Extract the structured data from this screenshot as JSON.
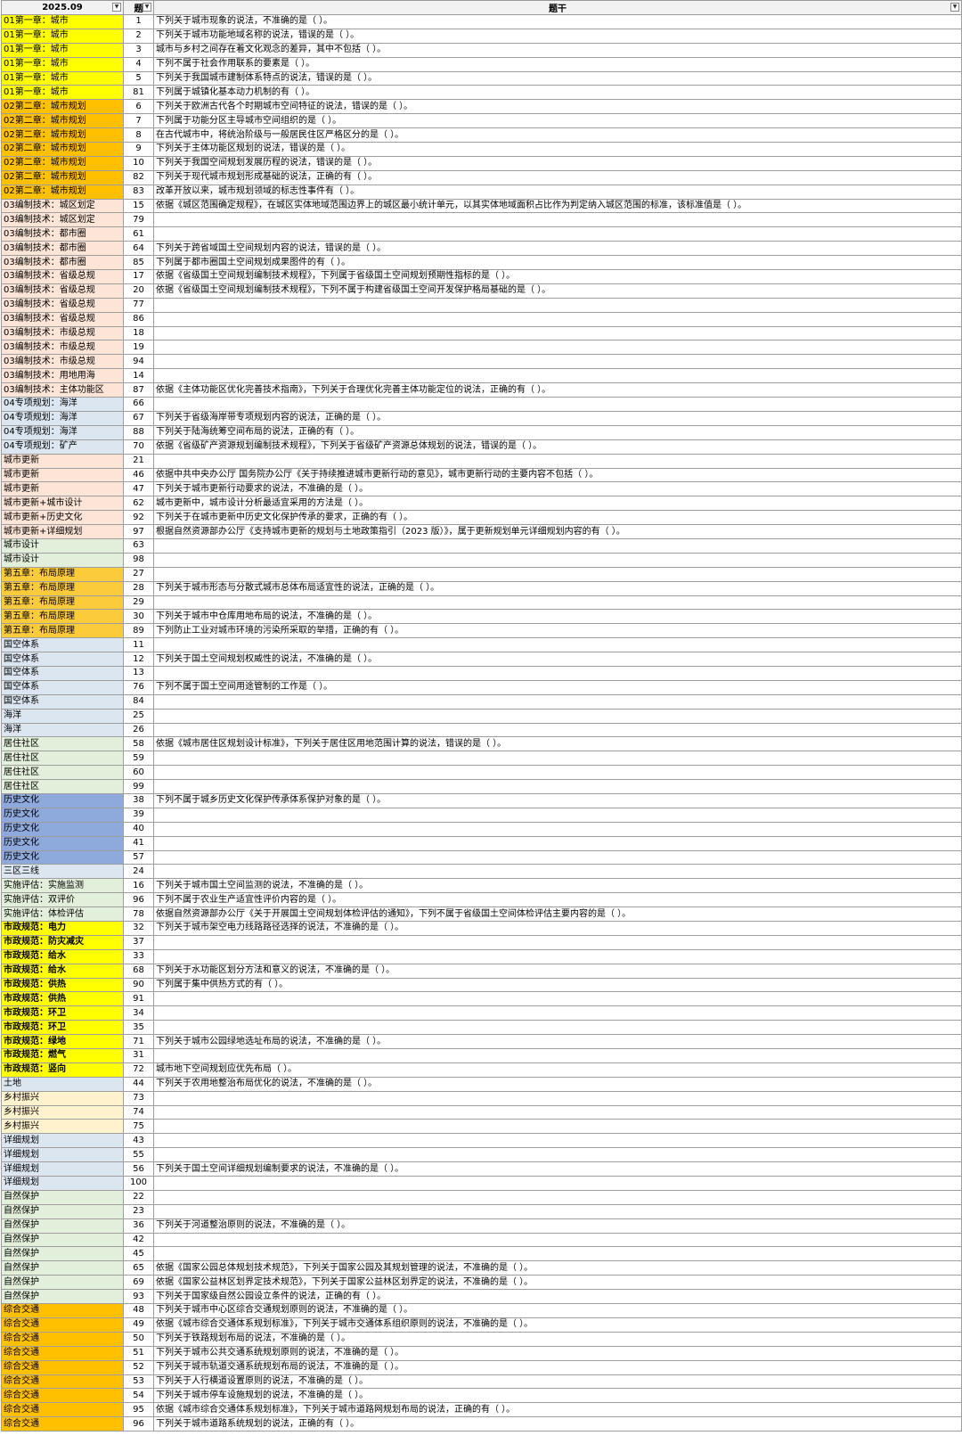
{
  "header": {
    "col1": "2025.09",
    "col2": "题",
    "col3": "题干"
  },
  "colors": {
    "yellow": "#ffff00",
    "orange": "#ffc000",
    "peach": "#fce4d6",
    "gold": "#fbcb3b",
    "light_blue": "#dce6f1",
    "blue": "#8ea9db",
    "light_green": "#e2efda",
    "sand": "#fff2cc",
    "white": "#ffffff"
  },
  "rows": [
    {
      "cat": "01第一章：城市",
      "n": "1",
      "text": "下列关于城市现象的说法，不准确的是（ ）。",
      "color": "yellow"
    },
    {
      "cat": "01第一章：城市",
      "n": "2",
      "text": "下列关于城市功能地域名称的说法，错误的是（ ）。",
      "color": "yellow"
    },
    {
      "cat": "01第一章：城市",
      "n": "3",
      "text": "城市与乡村之间存在着文化观念的差异，其中不包括（ ）。",
      "color": "yellow"
    },
    {
      "cat": "01第一章：城市",
      "n": "4",
      "text": "下列不属于社会作用联系的要素是（ ）。",
      "color": "yellow"
    },
    {
      "cat": "01第一章：城市",
      "n": "5",
      "text": "下列关于我国城市建制体系特点的说法，错误的是（ ）。",
      "color": "yellow"
    },
    {
      "cat": "01第一章：城市",
      "n": "81",
      "text": "下列属于城镇化基本动力机制的有（ ）。",
      "color": "yellow"
    },
    {
      "cat": "02第二章：城市规划",
      "n": "6",
      "text": "下列关于欧洲古代各个时期城市空间特征的说法，错误的是（ ）。",
      "color": "orange"
    },
    {
      "cat": "02第二章：城市规划",
      "n": "7",
      "text": "下列属于功能分区主导城市空间组织的是（ ）。",
      "color": "orange"
    },
    {
      "cat": "02第二章：城市规划",
      "n": "8",
      "text": "在古代城市中，将统治阶级与一般居民住区严格区分的是（ ）。",
      "color": "orange"
    },
    {
      "cat": "02第二章：城市规划",
      "n": "9",
      "text": "下列关于主体功能区规划的说法，错误的是（ ）。",
      "color": "orange"
    },
    {
      "cat": "02第二章：城市规划",
      "n": "10",
      "text": "下列关于我国空间规划发展历程的说法，错误的是（ ）。",
      "color": "orange"
    },
    {
      "cat": "02第二章：城市规划",
      "n": "82",
      "text": "下列关于现代城市规划形成基础的说法，正确的有（ ）。",
      "color": "orange"
    },
    {
      "cat": "02第二章：城市规划",
      "n": "83",
      "text": "改革开放以来，城市规划领域的标志性事件有（ ）。",
      "color": "orange"
    },
    {
      "cat": "03编制技术：城区划定",
      "n": "15",
      "text": "依据《城区范围确定规程》，在城区实体地域范围边界上的城区最小统计单元，以其实体地域面积占比作为判定纳入城区范围的标准，该标准值是（ ）。",
      "color": "peach"
    },
    {
      "cat": "03编制技术：城区划定",
      "n": "79",
      "text": "",
      "color": "peach"
    },
    {
      "cat": "03编制技术：都市圈",
      "n": "61",
      "text": "",
      "color": "peach"
    },
    {
      "cat": "03编制技术：都市圈",
      "n": "64",
      "text": "下列关于跨省域国土空间规划内容的说法，错误的是（ ）。",
      "color": "peach"
    },
    {
      "cat": "03编制技术：都市圈",
      "n": "85",
      "text": "下列属于都市圈国土空间规划成果图件的有（ ）。",
      "color": "peach"
    },
    {
      "cat": "03编制技术：省级总规",
      "n": "17",
      "text": "依据《省级国土空间规划编制技术规程》，下列属于省级国土空间规划预期性指标的是（ ）。",
      "color": "peach"
    },
    {
      "cat": "03编制技术：省级总规",
      "n": "20",
      "text": "依据《省级国土空间规划编制技术规程》，下列不属于构建省级国土空间开发保护格局基础的是（ ）。",
      "color": "peach"
    },
    {
      "cat": "03编制技术：省级总规",
      "n": "77",
      "text": "",
      "color": "peach"
    },
    {
      "cat": "03编制技术：省级总规",
      "n": "86",
      "text": "",
      "color": "peach"
    },
    {
      "cat": "03编制技术：市级总规",
      "n": "18",
      "text": "",
      "color": "peach"
    },
    {
      "cat": "03编制技术：市级总规",
      "n": "19",
      "text": "",
      "color": "peach"
    },
    {
      "cat": "03编制技术：市级总规",
      "n": "94",
      "text": "",
      "color": "peach"
    },
    {
      "cat": "03编制技术：用地用海",
      "n": "14",
      "text": "",
      "color": "peach"
    },
    {
      "cat": "03编制技术：主体功能区",
      "n": "87",
      "text": "依据《主体功能区优化完善技术指南》，下列关于合理优化完善主体功能定位的说法，正确的有（ ）。",
      "color": "peach"
    },
    {
      "cat": "04专项规划：海洋",
      "n": "66",
      "text": "",
      "color": "light_blue"
    },
    {
      "cat": "04专项规划：海洋",
      "n": "67",
      "text": "下列关于省级海岸带专项规划内容的说法，正确的是（ ）。",
      "color": "light_blue"
    },
    {
      "cat": "04专项规划：海洋",
      "n": "88",
      "text": "下列关于陆海统筹空间布局的说法，正确的有（ ）。",
      "color": "light_blue"
    },
    {
      "cat": "04专项规划：矿产",
      "n": "70",
      "text": "依据《省级矿产资源规划编制技术规程》，下列关于省级矿产资源总体规划的说法，错误的是（ ）。",
      "color": "light_blue"
    },
    {
      "cat": "城市更新",
      "n": "21",
      "text": "",
      "color": "peach"
    },
    {
      "cat": "城市更新",
      "n": "46",
      "text": "依据中共中央办公厅 国务院办公厅《关于持续推进城市更新行动的意见》，城市更新行动的主要内容不包括（ ）。",
      "color": "peach"
    },
    {
      "cat": "城市更新",
      "n": "47",
      "text": "下列关于城市更新行动要求的说法，不准确的是（ ）。",
      "color": "peach"
    },
    {
      "cat": "城市更新+城市设计",
      "n": "62",
      "text": "城市更新中，城市设计分析最适宜采用的方法是（ ）。",
      "color": "peach"
    },
    {
      "cat": "城市更新+历史文化",
      "n": "92",
      "text": "下列关于在城市更新中历史文化保护传承的要求，正确的有（ ）。",
      "color": "peach"
    },
    {
      "cat": "城市更新+详细规划",
      "n": "97",
      "text": "根据自然资源部办公厅《支持城市更新的规划与土地政策指引（2023 版）》，属于更新规划单元详细规划内容的有（ ）。",
      "color": "peach"
    },
    {
      "cat": "城市设计",
      "n": "63",
      "text": "",
      "color": "light_green"
    },
    {
      "cat": "城市设计",
      "n": "98",
      "text": "",
      "color": "light_green"
    },
    {
      "cat": "第五章：布局原理",
      "n": "27",
      "text": "",
      "color": "gold"
    },
    {
      "cat": "第五章：布局原理",
      "n": "28",
      "text": "下列关于城市形态与分散式城市总体布局适宜性的说法，正确的是（ ）。",
      "color": "gold"
    },
    {
      "cat": "第五章：布局原理",
      "n": "29",
      "text": "",
      "color": "gold"
    },
    {
      "cat": "第五章：布局原理",
      "n": "30",
      "text": "下列关于城市中仓库用地布局的说法，不准确的是（ ）。",
      "color": "gold"
    },
    {
      "cat": "第五章：布局原理",
      "n": "89",
      "text": "下列防止工业对城市环境的污染所采取的举措，正确的有（ ）。",
      "color": "gold"
    },
    {
      "cat": "国空体系",
      "n": "11",
      "text": "",
      "color": "light_blue"
    },
    {
      "cat": "国空体系",
      "n": "12",
      "text": "下列关于国土空间规划权威性的说法，不准确的是（ ）。",
      "color": "light_blue"
    },
    {
      "cat": "国空体系",
      "n": "13",
      "text": "",
      "color": "light_blue"
    },
    {
      "cat": "国空体系",
      "n": "76",
      "text": "下列不属于国土空间用途管制的工作是（ ）。",
      "color": "light_blue"
    },
    {
      "cat": "国空体系",
      "n": "84",
      "text": "",
      "color": "light_blue"
    },
    {
      "cat": "海洋",
      "n": "25",
      "text": "",
      "color": "light_blue"
    },
    {
      "cat": "海洋",
      "n": "26",
      "text": "",
      "color": "light_blue"
    },
    {
      "cat": "居住社区",
      "n": "58",
      "text": "依据《城市居住区规划设计标准》，下列关于居住区用地范围计算的说法，错误的是（ ）。",
      "color": "light_green"
    },
    {
      "cat": "居住社区",
      "n": "59",
      "text": "",
      "color": "light_green"
    },
    {
      "cat": "居住社区",
      "n": "60",
      "text": "",
      "color": "light_green"
    },
    {
      "cat": "居住社区",
      "n": "99",
      "text": "",
      "color": "light_green"
    },
    {
      "cat": "历史文化",
      "n": "38",
      "text": "下列不属于城乡历史文化保护传承体系保护对象的是（ ）。",
      "color": "blue"
    },
    {
      "cat": "历史文化",
      "n": "39",
      "text": "",
      "color": "blue"
    },
    {
      "cat": "历史文化",
      "n": "40",
      "text": "",
      "color": "blue"
    },
    {
      "cat": "历史文化",
      "n": "41",
      "text": "",
      "color": "blue"
    },
    {
      "cat": "历史文化",
      "n": "57",
      "text": "",
      "color": "blue"
    },
    {
      "cat": "三区三线",
      "n": "24",
      "text": "",
      "color": "light_blue"
    },
    {
      "cat": "实施评估：实施监测",
      "n": "16",
      "text": "下列关于城市国土空间监测的说法，不准确的是（ ）。",
      "color": "light_green"
    },
    {
      "cat": "实施评估：双评价",
      "n": "96",
      "text": "下列不属于农业生产适宜性评价内容的是（ ）。",
      "color": "light_green"
    },
    {
      "cat": "实施评估：体检评估",
      "n": "78",
      "text": "依据自然资源部办公厅《关于开展国土空间规划体检评估的通知》，下列不属于省级国土空间体检评估主要内容的是（ ）。",
      "color": "light_green"
    },
    {
      "cat": "市政规范：电力",
      "n": "32",
      "text": "下列关于城市架空电力线路路径选择的说法，不准确的是（ ）。",
      "color": "yellow"
    },
    {
      "cat": "市政规范：防灾减灾",
      "n": "37",
      "text": "",
      "color": "yellow"
    },
    {
      "cat": "市政规范：给水",
      "n": "33",
      "text": "",
      "color": "yellow"
    },
    {
      "cat": "市政规范：给水",
      "n": "68",
      "text": "下列关于水功能区划分方法和意义的说法，不准确的是（ ）。",
      "color": "yellow"
    },
    {
      "cat": "市政规范：供热",
      "n": "90",
      "text": "下列属于集中供热方式的有（ ）。",
      "color": "yellow"
    },
    {
      "cat": "市政规范：供热",
      "n": "91",
      "text": "",
      "color": "yellow"
    },
    {
      "cat": "市政规范：环卫",
      "n": "34",
      "text": "",
      "color": "yellow"
    },
    {
      "cat": "市政规范：环卫",
      "n": "35",
      "text": "",
      "color": "yellow"
    },
    {
      "cat": "市政规范：绿地",
      "n": "71",
      "text": "下列关于城市公园绿地选址布局的说法，不准确的是（ ）。",
      "color": "yellow"
    },
    {
      "cat": "市政规范：燃气",
      "n": "31",
      "text": "",
      "color": "yellow"
    },
    {
      "cat": "市政规范：竖向",
      "n": "72",
      "text": "城市地下空间规划应优先布局（ ）。",
      "color": "yellow"
    },
    {
      "cat": "土地",
      "n": "44",
      "text": "下列关于农用地整治布局优化的说法，不准确的是（ ）。",
      "color": "light_blue"
    },
    {
      "cat": "乡村振兴",
      "n": "73",
      "text": "",
      "color": "sand"
    },
    {
      "cat": "乡村振兴",
      "n": "74",
      "text": "",
      "color": "sand"
    },
    {
      "cat": "乡村振兴",
      "n": "75",
      "text": "",
      "color": "sand"
    },
    {
      "cat": "详细规划",
      "n": "43",
      "text": "",
      "color": "light_blue"
    },
    {
      "cat": "详细规划",
      "n": "55",
      "text": "",
      "color": "light_blue"
    },
    {
      "cat": "详细规划",
      "n": "56",
      "text": "下列关于国土空间详细规划编制要求的说法，不准确的是（ ）。",
      "color": "light_blue"
    },
    {
      "cat": "详细规划",
      "n": "100",
      "text": "",
      "color": "light_blue"
    },
    {
      "cat": "自然保护",
      "n": "22",
      "text": "",
      "color": "light_green"
    },
    {
      "cat": "自然保护",
      "n": "23",
      "text": "",
      "color": "light_green"
    },
    {
      "cat": "自然保护",
      "n": "36",
      "text": "下列关于河道整治原则的说法，不准确的是（ ）。",
      "color": "light_green"
    },
    {
      "cat": "自然保护",
      "n": "42",
      "text": "",
      "color": "light_green"
    },
    {
      "cat": "自然保护",
      "n": "45",
      "text": "",
      "color": "light_green"
    },
    {
      "cat": "自然保护",
      "n": "65",
      "text": "依据《国家公园总体规划技术规范》，下列关于国家公园及其规划管理的说法，不准确的是（ ）。",
      "color": "light_green"
    },
    {
      "cat": "自然保护",
      "n": "69",
      "text": "依据《国家公益林区划界定技术规范》，下列关于国家公益林区划界定的说法，不准确的是（ ）。",
      "color": "light_green"
    },
    {
      "cat": "自然保护",
      "n": "93",
      "text": "下列关于国家级自然公园设立条件的说法，正确的有（ ）。",
      "color": "light_green"
    },
    {
      "cat": "综合交通",
      "n": "48",
      "text": "下列关于城市中心区综合交通规划原则的说法，不准确的是（ ）。",
      "color": "orange"
    },
    {
      "cat": "综合交通",
      "n": "49",
      "text": "依据《城市综合交通体系规划标准》，下列关于城市交通体系组织原则的说法，不准确的是（ ）。",
      "color": "orange"
    },
    {
      "cat": "综合交通",
      "n": "50",
      "text": "下列关于铁路规划布局的说法，不准确的是（ ）。",
      "color": "orange"
    },
    {
      "cat": "综合交通",
      "n": "51",
      "text": "下列关于城市公共交通系统规划原则的说法，不准确的是（ ）。",
      "color": "orange"
    },
    {
      "cat": "综合交通",
      "n": "52",
      "text": "下列关于城市轨道交通系统规划布局的说法，不准确的是（ ）。",
      "color": "orange"
    },
    {
      "cat": "综合交通",
      "n": "53",
      "text": "下列关于人行横道设置原则的说法，不准确的是（ ）。",
      "color": "orange"
    },
    {
      "cat": "综合交通",
      "n": "54",
      "text": "下列关于城市停车设施规划的说法，不准确的是（ ）。",
      "color": "orange"
    },
    {
      "cat": "综合交通",
      "n": "95",
      "text": "依据《城市综合交通体系规划标准》，下列关于城市道路网规划布局的说法，正确的有（ ）。",
      "color": "orange"
    },
    {
      "cat": "综合交通",
      "n": "96",
      "text": "下列关于城市道路系统规划的说法，正确的有（ ）。",
      "color": "orange"
    }
  ]
}
